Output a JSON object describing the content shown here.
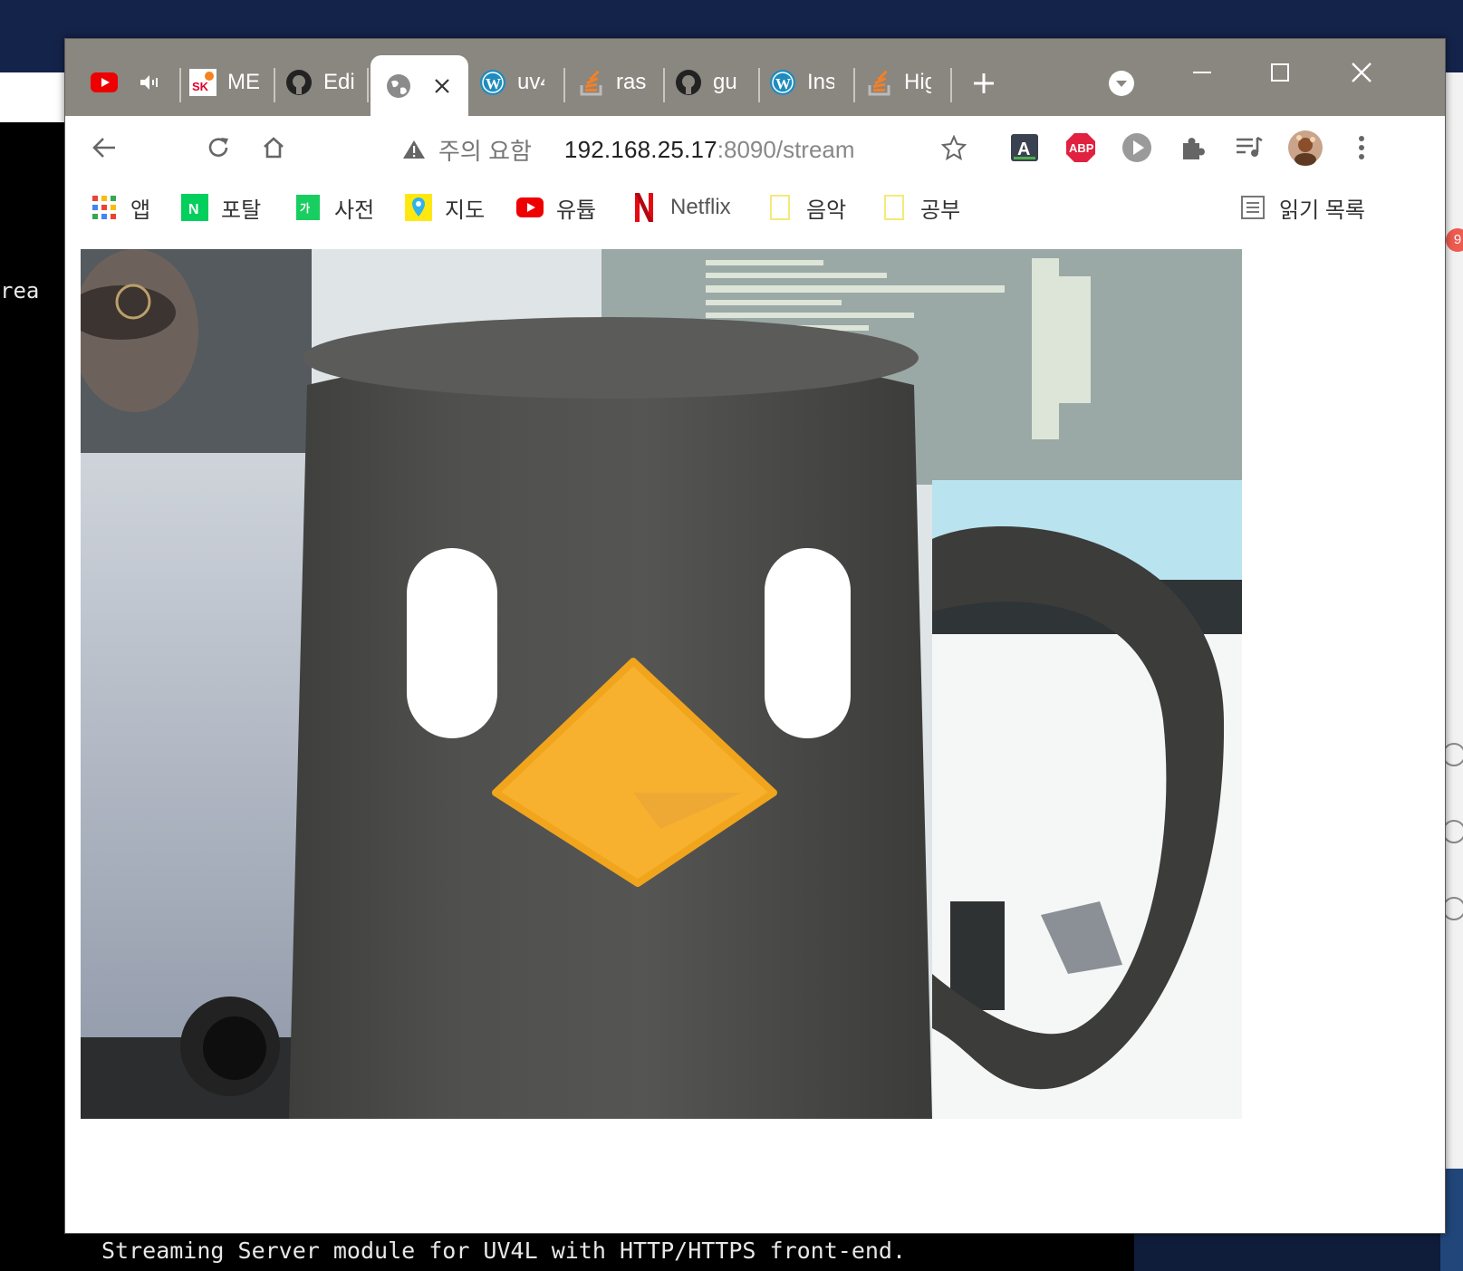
{
  "background": {
    "terminal_fragment": "rea",
    "terminal_bottom_line": "Streaming Server module for UV4L with HTTP/HTTPS front-end.",
    "notification_badge": "9"
  },
  "tabs": [
    {
      "label": "",
      "icon": "youtube-icon",
      "extra": "speaker-icon"
    },
    {
      "label": "ME",
      "icon": "sk-icon"
    },
    {
      "label": "Edi",
      "icon": "github-icon"
    },
    {
      "label": "",
      "icon": "globe-icon",
      "active": true
    },
    {
      "label": "uv4",
      "icon": "wordpress-icon"
    },
    {
      "label": "ras",
      "icon": "stackoverflow-icon"
    },
    {
      "label": "gu",
      "icon": "github-icon"
    },
    {
      "label": "Ins",
      "icon": "wordpress-icon"
    },
    {
      "label": "Hig",
      "icon": "stackoverflow-icon"
    }
  ],
  "omnibox": {
    "warning_text": "주의 요함",
    "url_host": "192.168.25.17",
    "url_rest": ":8090/stream"
  },
  "bookmarks": [
    {
      "label": "앱",
      "icon": "apps-grid-icon"
    },
    {
      "label": "포탈",
      "icon": "naver-icon"
    },
    {
      "label": "사전",
      "icon": "dictionary-icon"
    },
    {
      "label": "지도",
      "icon": "map-pin-icon"
    },
    {
      "label": "유튭",
      "icon": "youtube-icon"
    },
    {
      "label": "Netflix",
      "icon": "netflix-icon"
    },
    {
      "label": "음악",
      "icon": "folder-icon"
    },
    {
      "label": "공부",
      "icon": "folder-icon"
    }
  ],
  "reading_list": "읽기 목록",
  "colors": {
    "tabstrip": "#8a8680",
    "mug": "#4b4b49",
    "beak": "#f7b12e"
  }
}
